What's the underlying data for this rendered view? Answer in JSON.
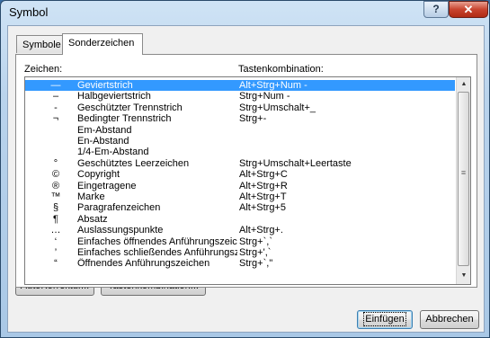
{
  "window": {
    "title": "Symbol",
    "help_glyph": "?",
    "close_glyph": "✕"
  },
  "tabs": [
    {
      "label": "Symbole",
      "active": false
    },
    {
      "label": "Sonderzeichen",
      "active": true
    }
  ],
  "columns": {
    "symbol": "Zeichen:",
    "shortcut": "Tastenkombination:"
  },
  "rows": [
    {
      "symbol": "—",
      "name": "Geviertstrich",
      "shortcut": "Alt+Strg+Num -",
      "selected": true
    },
    {
      "symbol": "–",
      "name": "Halbgeviertstrich",
      "shortcut": "Strg+Num -"
    },
    {
      "symbol": "-",
      "name": "Geschützter Trennstrich",
      "shortcut": "Strg+Umschalt+_"
    },
    {
      "symbol": "¬",
      "name": "Bedingter Trennstrich",
      "shortcut": "Strg+-"
    },
    {
      "symbol": "",
      "name": "Em-Abstand",
      "shortcut": ""
    },
    {
      "symbol": "",
      "name": "En-Abstand",
      "shortcut": ""
    },
    {
      "symbol": "",
      "name": "1/4-Em-Abstand",
      "shortcut": ""
    },
    {
      "symbol": "°",
      "name": "Geschütztes Leerzeichen",
      "shortcut": "Strg+Umschalt+Leertaste"
    },
    {
      "symbol": "©",
      "name": "Copyright",
      "shortcut": "Alt+Strg+C"
    },
    {
      "symbol": "®",
      "name": "Eingetragene",
      "shortcut": "Alt+Strg+R"
    },
    {
      "symbol": "™",
      "name": "Marke",
      "shortcut": "Alt+Strg+T"
    },
    {
      "symbol": "§",
      "name": "Paragrafenzeichen",
      "shortcut": "Alt+Strg+5"
    },
    {
      "symbol": "¶",
      "name": "Absatz",
      "shortcut": ""
    },
    {
      "symbol": "…",
      "name": "Auslassungspunkte",
      "shortcut": "Alt+Strg+."
    },
    {
      "symbol": "‘",
      "name": "Einfaches öffnendes Anführungszeich…",
      "shortcut": "Strg+`,`"
    },
    {
      "symbol": "’",
      "name": "Einfaches schließendes Anführungszei…",
      "shortcut": "Strg+',`"
    },
    {
      "symbol": "“",
      "name": "Öffnendes Anführungszeichen",
      "shortcut": "Strg+`,\""
    }
  ],
  "buttons": {
    "autocorrect": "AutoKorrektur...",
    "shortcut": "Tastenkombination...",
    "insert": "Einfügen",
    "cancel": "Abbrechen"
  },
  "scrollbar": {
    "up_glyph": "▲",
    "down_glyph": "▼",
    "grip_glyph": "≡"
  },
  "colors": {
    "selection": "#3399ff",
    "close_button": "#c8442f"
  }
}
